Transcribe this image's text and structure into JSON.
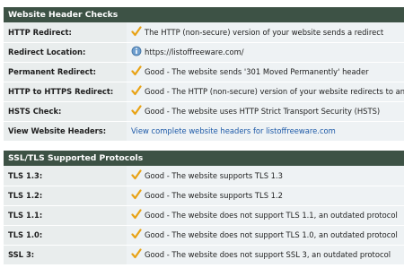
{
  "section1": {
    "title": "Website Header Checks",
    "rows": [
      {
        "label": "HTTP Redirect:",
        "icon": "checkmark-icon",
        "value": "The HTTP (non-secure) version of your website sends a redirect"
      },
      {
        "label": "Redirect Location:",
        "icon": "globe-icon",
        "value": "https://listoffreeware.com/"
      },
      {
        "label": "Permanent Redirect:",
        "icon": "checkmark-icon",
        "value": "Good - The website sends '301 Moved Permanently' header"
      },
      {
        "label": "HTTP to HTTPS Redirect:",
        "icon": "checkmark-icon",
        "value": "Good - The HTTP (non-secure) version of your website redirects to an HTTPS"
      },
      {
        "label": "HSTS Check:",
        "icon": "checkmark-icon",
        "value": "Good - The website uses HTTP Strict Transport Security (HSTS)"
      },
      {
        "label": "View Website Headers:",
        "link": "View complete website headers for listoffreeware.com"
      }
    ]
  },
  "section2": {
    "title": "SSL/TLS Supported Protocols",
    "rows": [
      {
        "label": "TLS 1.3:",
        "icon": "checkmark-icon",
        "value": "Good - The website supports TLS 1.3"
      },
      {
        "label": "TLS 1.2:",
        "icon": "checkmark-icon",
        "value": "Good - The website supports TLS 1.2"
      },
      {
        "label": "TLS 1.1:",
        "icon": "checkmark-icon",
        "value": "Good - The website does not support TLS 1.1, an outdated protocol"
      },
      {
        "label": "TLS 1.0:",
        "icon": "checkmark-icon",
        "value": "Good - The website does not support TLS 1.0, an outdated protocol"
      },
      {
        "label": "SSL 3:",
        "icon": "checkmark-icon",
        "value": "Good - The website does not support SSL 3, an outdated protocol"
      }
    ]
  },
  "colors": {
    "header_bg": "#3d5245",
    "label_bg": "#e9eded",
    "value_bg": "#eef2f4",
    "check": "#e8a317",
    "link": "#1e5aa8"
  }
}
